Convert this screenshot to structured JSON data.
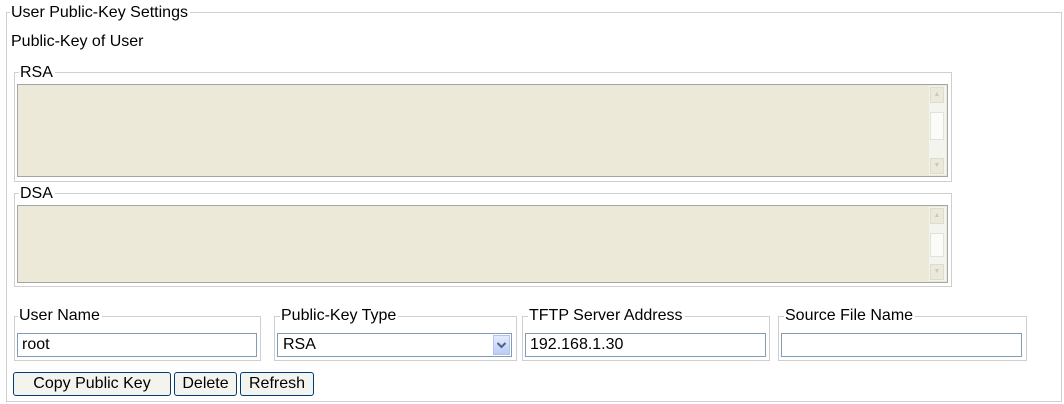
{
  "page": {
    "title": "User Public-Key Settings",
    "subtitle": "Public-Key of User"
  },
  "rsa": {
    "legend": "RSA",
    "value": ""
  },
  "dsa": {
    "legend": "DSA",
    "value": ""
  },
  "form": {
    "user_name": {
      "label": "User Name",
      "value": "root"
    },
    "key_type": {
      "label": "Public-Key Type",
      "selected": "RSA"
    },
    "tftp": {
      "label": "TFTP Server Address",
      "value": "192.168.1.30"
    },
    "source_file": {
      "label": "Source File Name",
      "value": ""
    }
  },
  "buttons": {
    "copy": "Copy Public Key",
    "delete": "Delete",
    "refresh": "Refresh"
  }
}
